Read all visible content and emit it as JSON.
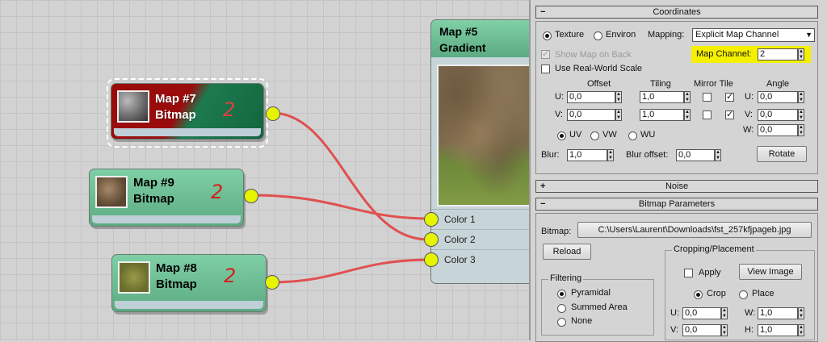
{
  "nodes": [
    {
      "id": "map7",
      "title": "Map #7",
      "type": "Bitmap",
      "note": "2",
      "selected": true
    },
    {
      "id": "map9",
      "title": "Map #9",
      "type": "Bitmap",
      "note": "2",
      "selected": false
    },
    {
      "id": "map8",
      "title": "Map #8",
      "type": "Bitmap",
      "note": "2",
      "selected": false
    }
  ],
  "gradient_node": {
    "title": "Map #5",
    "type": "Gradient",
    "ports": [
      "Color 1",
      "Color 2",
      "Color 3"
    ]
  },
  "coordinates": {
    "header": "Coordinates",
    "texture_label": "Texture",
    "environ_label": "Environ",
    "mapping_label": "Mapping:",
    "mapping_value": "Explicit Map Channel",
    "show_map_label": "Show Map on Back",
    "map_channel_label": "Map Channel:",
    "map_channel_value": "2",
    "real_world_label": "Use Real-World Scale",
    "offset_label": "Offset",
    "tiling_label": "Tiling",
    "mirror_tile_label": "Mirror Tile",
    "angle_label": "Angle",
    "u_label": "U:",
    "v_label": "V:",
    "w_label": "W:",
    "offset_u": "0,0",
    "offset_v": "0,0",
    "tiling_u": "1,0",
    "tiling_v": "1,0",
    "angle_u": "0,0",
    "angle_v": "0,0",
    "angle_w": "0,0",
    "uv_label": "UV",
    "vw_label": "VW",
    "wu_label": "WU",
    "blur_label": "Blur:",
    "blur_value": "1,0",
    "blur_offset_label": "Blur offset:",
    "blur_offset_value": "0,0",
    "rotate_label": "Rotate"
  },
  "noise": {
    "header": "Noise"
  },
  "bitmap_params": {
    "header": "Bitmap Parameters",
    "bitmap_label": "Bitmap:",
    "bitmap_path": "C:\\Users\\Laurent\\Downloads\\fst_257kfjpageb.jpg",
    "reload_label": "Reload",
    "cropping_label": "Cropping/Placement",
    "apply_label": "Apply",
    "view_image_label": "View Image",
    "crop_label": "Crop",
    "place_label": "Place",
    "u_label": "U:",
    "v_label": "V:",
    "w_label": "W:",
    "h_label": "H:",
    "crop_u": "0,0",
    "crop_v": "0,0",
    "crop_w": "1,0",
    "crop_h": "1,0",
    "filtering_label": "Filtering",
    "pyramidal_label": "Pyramidal",
    "summed_label": "Summed Area",
    "none_label": "None"
  },
  "colors": {
    "accent_highlight": "#f5f000",
    "wire": "#e05050",
    "socket": "#e6f400",
    "node_green": "#5cab82",
    "node_selected_red": "#9a0c0c"
  },
  "icons": {
    "expand": "plus-icon",
    "collapse": "minus-icon"
  }
}
